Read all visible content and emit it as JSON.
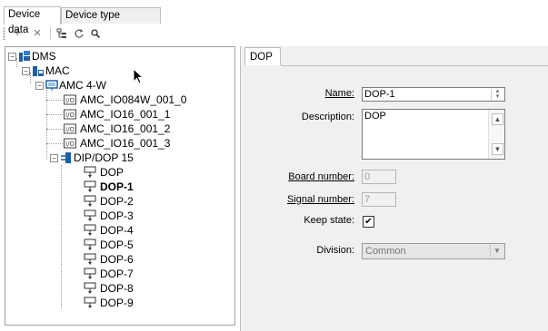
{
  "tabs": [
    {
      "label": "Device data",
      "active": true
    },
    {
      "label": "Device type assignment",
      "active": false
    }
  ],
  "toolbar": {
    "add_icon": "+",
    "delete_icon": "×",
    "tree_icon": "⊞",
    "refresh_icon": "⟳",
    "search_icon": "⌕"
  },
  "tree": {
    "root": "DMS",
    "mac": "MAC",
    "amc": "AMC 4-W",
    "io_modules": [
      "AMC_IO084W_001_0",
      "AMC_IO16_001_1",
      "AMC_IO16_001_2",
      "AMC_IO16_001_3"
    ],
    "dip": "DIP/DOP 15",
    "dop_items": [
      "DOP",
      "DOP-1",
      "DOP-2",
      "DOP-3",
      "DOP-4",
      "DOP-5",
      "DOP-6",
      "DOP-7",
      "DOP-8",
      "DOP-9"
    ],
    "selected": "DOP-1"
  },
  "detail": {
    "tab_label": "DOP",
    "name_label": "Name:",
    "name_value": "DOP-1",
    "description_label": "Description:",
    "description_value": "DOP",
    "board_number_label": "Board number:",
    "board_number_value": "0",
    "signal_number_label": "Signal number:",
    "signal_number_value": "7",
    "keep_state_label": "Keep state:",
    "keep_state_checked": true,
    "division_label": "Division:",
    "division_value": "Common"
  },
  "colors": {
    "accent_blue": "#1f5fa8",
    "panel_bg": "#f0f0f0",
    "border": "#bdbdbd"
  }
}
